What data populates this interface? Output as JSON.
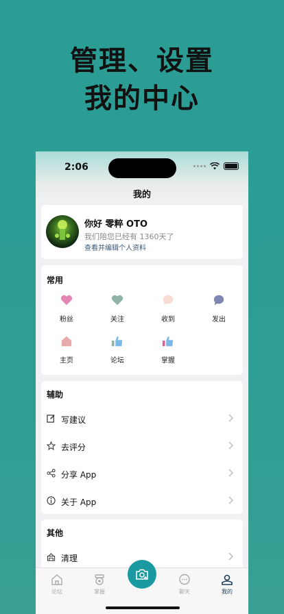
{
  "hero": {
    "line1": "管理、设置",
    "line2": "我的中心"
  },
  "status": {
    "time": "2:06"
  },
  "nav": {
    "title": "我的"
  },
  "profile": {
    "name": "你好 零粹 OTO",
    "subtitle": "我们陪您已经有 1360天了",
    "edit_link": "查看并编辑个人资料"
  },
  "common": {
    "title": "常用",
    "items": [
      {
        "label": "粉丝",
        "icon": "heart-icon",
        "color": "#e487b4"
      },
      {
        "label": "关注",
        "icon": "heart-icon",
        "color": "#8fb3a4"
      },
      {
        "label": "收到",
        "icon": "chat-bubble-icon",
        "color": "#f6dcd3"
      },
      {
        "label": "发出",
        "icon": "chat-bubble-icon",
        "color": "#7f86b3"
      },
      {
        "label": "主页",
        "icon": "home-icon",
        "color": "#e8a9ad"
      },
      {
        "label": "论坛",
        "icon": "thumbs-up-icon",
        "color": "#7ab8e6"
      },
      {
        "label": "掌握",
        "icon": "thumbs-up-icon",
        "color": "#e05a9c"
      }
    ]
  },
  "assist": {
    "title": "辅助",
    "items": [
      {
        "label": "写建议",
        "icon": "edit-icon"
      },
      {
        "label": "去评分",
        "icon": "star-icon"
      },
      {
        "label": "分享 App",
        "icon": "share-icon"
      },
      {
        "label": "关于 App",
        "icon": "info-icon"
      }
    ]
  },
  "other": {
    "title": "其他",
    "items": [
      {
        "label": "清理",
        "icon": "clean-icon"
      }
    ]
  },
  "tabbar": {
    "items": [
      {
        "label": "论坛",
        "icon": "home-icon"
      },
      {
        "label": "掌握",
        "icon": "badge-icon"
      },
      {
        "label": "",
        "icon": "camera-icon"
      },
      {
        "label": "聊天",
        "icon": "chat-icon"
      },
      {
        "label": "我的",
        "icon": "person-icon"
      }
    ]
  }
}
